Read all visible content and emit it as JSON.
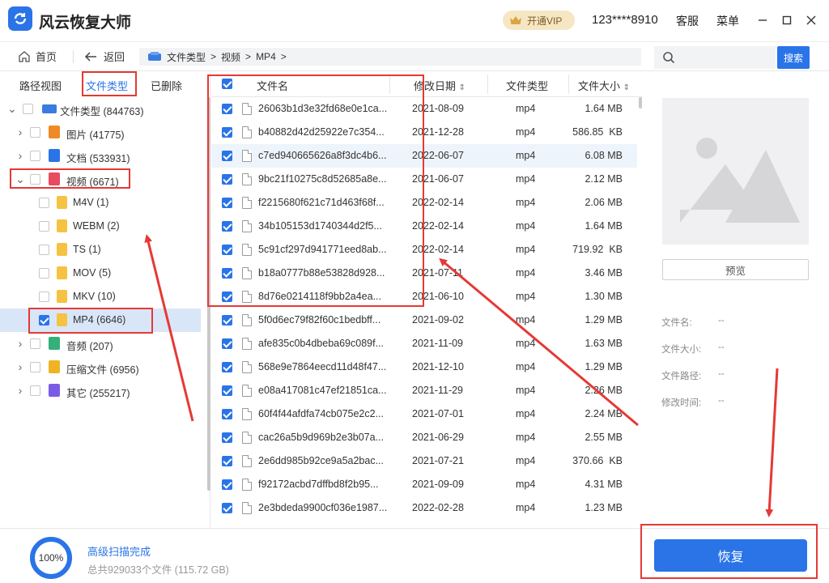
{
  "app": {
    "title": "风云恢复大师",
    "vip_label": "开通VIP",
    "account": "123****8910",
    "service_label": "客服",
    "menu_label": "菜单"
  },
  "nav": {
    "home_label": "首页",
    "back_label": "返回",
    "breadcrumb": [
      "文件类型",
      "视频",
      "MP4"
    ],
    "search_placeholder": "",
    "search_button": "搜索"
  },
  "sidebar": {
    "tabs": [
      {
        "label": "路径视图",
        "active": false
      },
      {
        "label": "文件类型",
        "active": true
      },
      {
        "label": "已删除",
        "active": false
      }
    ],
    "tree": [
      {
        "label": "文件类型 (844763)",
        "level": 0,
        "icon": "drive-icon",
        "expanded": true,
        "checked": false
      },
      {
        "label": "图片 (41775)",
        "level": 1,
        "icon": "image-folder-icon",
        "expanded": false,
        "checked": false
      },
      {
        "label": "文档 (533931)",
        "level": 1,
        "icon": "document-folder-icon",
        "expanded": false,
        "checked": false
      },
      {
        "label": "视频 (6671)",
        "level": 1,
        "icon": "video-folder-icon",
        "expanded": true,
        "checked": false
      },
      {
        "label": "M4V (1)",
        "level": 2,
        "icon": "folder-icon",
        "checked": false
      },
      {
        "label": "WEBM (2)",
        "level": 2,
        "icon": "folder-icon",
        "checked": false
      },
      {
        "label": "TS (1)",
        "level": 2,
        "icon": "folder-icon",
        "checked": false
      },
      {
        "label": "MOV (5)",
        "level": 2,
        "icon": "folder-icon",
        "checked": false
      },
      {
        "label": "MKV (10)",
        "level": 2,
        "icon": "folder-icon",
        "checked": false
      },
      {
        "label": "MP4 (6646)",
        "level": 2,
        "icon": "folder-icon",
        "checked": true,
        "selected": true
      },
      {
        "label": "音频 (207)",
        "level": 1,
        "icon": "audio-folder-icon",
        "expanded": false,
        "checked": false
      },
      {
        "label": "压缩文件 (6956)",
        "level": 1,
        "icon": "archive-folder-icon",
        "expanded": false,
        "checked": false
      },
      {
        "label": "其它 (255217)",
        "level": 1,
        "icon": "other-folder-icon",
        "expanded": false,
        "checked": false
      }
    ]
  },
  "table": {
    "columns": [
      "文件名",
      "修改日期",
      "文件类型",
      "文件大小"
    ],
    "rows": [
      {
        "name": "26063b1d3e32fd68e0e1ca...",
        "date": "2021-08-09",
        "type": "mp4",
        "size": "1.64 MB"
      },
      {
        "name": "b40882d42d25922e7c354...",
        "date": "2021-12-28",
        "type": "mp4",
        "size": "586.85  KB"
      },
      {
        "name": "c7ed940665626a8f3dc4b6...",
        "date": "2022-06-07",
        "type": "mp4",
        "size": "6.08 MB"
      },
      {
        "name": "9bc21f10275c8d52685a8e...",
        "date": "2021-06-07",
        "type": "mp4",
        "size": "2.12 MB"
      },
      {
        "name": "f2215680f621c71d463f68f...",
        "date": "2022-02-14",
        "type": "mp4",
        "size": "2.06 MB"
      },
      {
        "name": "34b105153d1740344d2f5...",
        "date": "2022-02-14",
        "type": "mp4",
        "size": "1.64 MB"
      },
      {
        "name": "5c91cf297d941771eed8ab...",
        "date": "2022-02-14",
        "type": "mp4",
        "size": "719.92  KB"
      },
      {
        "name": "b18a0777b88e53828d928...",
        "date": "2021-07-11",
        "type": "mp4",
        "size": "3.46 MB"
      },
      {
        "name": "8d76e0214118f9bb2a4ea...",
        "date": "2021-06-10",
        "type": "mp4",
        "size": "1.30 MB"
      },
      {
        "name": "5f0d6ec79f82f60c1bedbff...",
        "date": "2021-09-02",
        "type": "mp4",
        "size": "1.29 MB"
      },
      {
        "name": "afe835c0b4dbeba69c089f...",
        "date": "2021-11-09",
        "type": "mp4",
        "size": "1.63 MB"
      },
      {
        "name": "568e9e7864eecd11d48f47...",
        "date": "2021-12-10",
        "type": "mp4",
        "size": "1.29 MB"
      },
      {
        "name": "e08a417081c47ef21851ca...",
        "date": "2021-11-29",
        "type": "mp4",
        "size": "2.26 MB"
      },
      {
        "name": "60f4f44afdfa74cb075e2c2...",
        "date": "2021-07-01",
        "type": "mp4",
        "size": "2.24 MB"
      },
      {
        "name": "cac26a5b9d969b2e3b07a...",
        "date": "2021-06-29",
        "type": "mp4",
        "size": "2.55 MB"
      },
      {
        "name": "2e6dd985b92ce9a5a2bac...",
        "date": "2021-07-21",
        "type": "mp4",
        "size": "370.66  KB"
      },
      {
        "name": "f92172acbd7dffbd8f2b95...",
        "date": "2021-09-09",
        "type": "mp4",
        "size": "4.31 MB"
      },
      {
        "name": "2e3bdeda9900cf036e1987...",
        "date": "2022-02-28",
        "type": "mp4",
        "size": "1.23 MB"
      }
    ]
  },
  "preview": {
    "button_label": "预览",
    "fields": [
      {
        "label": "文件名:",
        "value": "--"
      },
      {
        "label": "文件大小:",
        "value": "--"
      },
      {
        "label": "文件路径:",
        "value": "--"
      },
      {
        "label": "修改时间:",
        "value": "--"
      }
    ]
  },
  "status": {
    "progress_percent": 100,
    "progress_text": "100%",
    "scan_status": "高级扫描完成",
    "summary": "总共929033个文件 (115.72 GB)",
    "recover_label": "恢复"
  },
  "colors": {
    "accent": "#2a74e8",
    "annotation": "#e53935",
    "vip_bg": "#f6e6c4"
  }
}
